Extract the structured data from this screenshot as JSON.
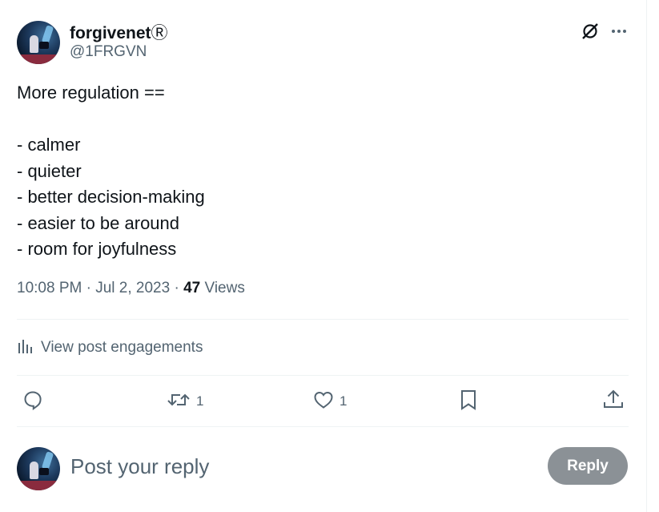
{
  "author": {
    "display_name": "forgivenet",
    "registered_mark": "Ⓡ",
    "handle": "@1FRGVN"
  },
  "post": {
    "lines": [
      "More regulation ==",
      "",
      "- calmer",
      "- quieter",
      "- better decision-making",
      "- easier to be around",
      "- room for joyfulness"
    ],
    "time": "10:08 PM",
    "date": "Jul 2, 2023",
    "separator": " · ",
    "views_count": "47",
    "views_label": "Views"
  },
  "engagements_link": "View post engagements",
  "actions": {
    "reply": {
      "icon": "comment-icon",
      "count": ""
    },
    "repost": {
      "icon": "repost-icon",
      "count": "1"
    },
    "like": {
      "icon": "heart-icon",
      "count": "1"
    },
    "bookmark": {
      "icon": "bookmark-icon",
      "count": ""
    },
    "share": {
      "icon": "share-icon",
      "count": ""
    }
  },
  "reply_box": {
    "placeholder": "Post your reply",
    "button_label": "Reply"
  },
  "colors": {
    "text": "#0f1419",
    "secondary": "#536471",
    "divider": "#eff3f4",
    "reply_button_bg": "#8b9196"
  }
}
